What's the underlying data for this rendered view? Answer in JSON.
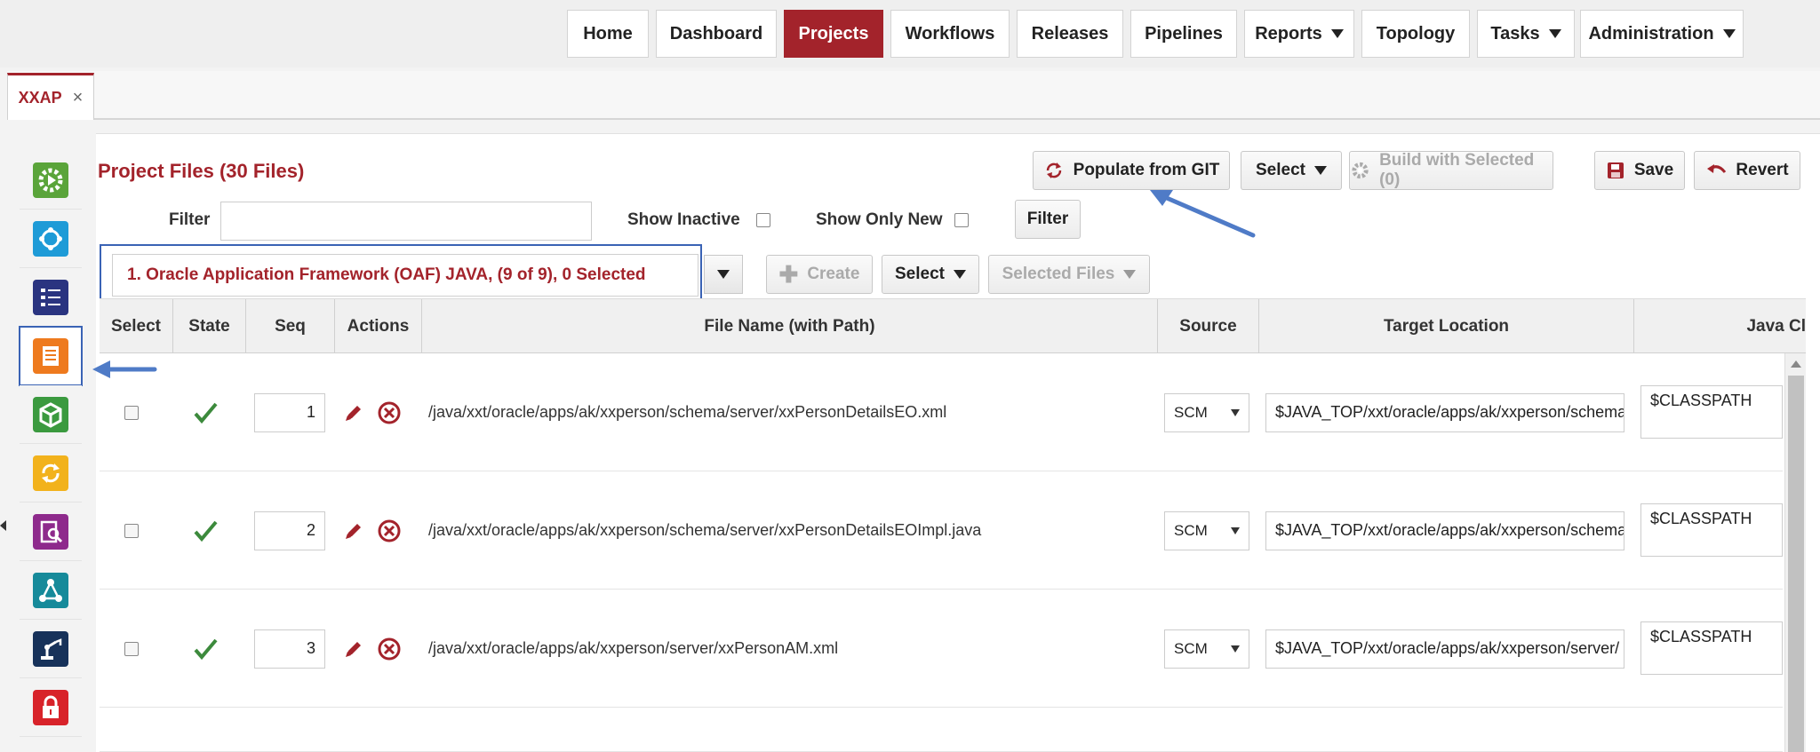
{
  "nav": {
    "items": [
      {
        "label": "Home"
      },
      {
        "label": "Dashboard"
      },
      {
        "label": "Projects"
      },
      {
        "label": "Workflows"
      },
      {
        "label": "Releases"
      },
      {
        "label": "Pipelines"
      },
      {
        "label": "Reports"
      },
      {
        "label": "Topology"
      },
      {
        "label": "Tasks"
      },
      {
        "label": "Administration"
      }
    ],
    "active": "Projects"
  },
  "tab": {
    "label": "XXAP",
    "close": "×"
  },
  "sidebar": {
    "icons": [
      "deploy-gear-icon",
      "network-icon",
      "checklist-icon",
      "project-files-icon",
      "package-cube-icon",
      "refresh-icon",
      "report-search-icon",
      "topology-icon",
      "robot-arm-icon",
      "lock-icon"
    ]
  },
  "page": {
    "title": "Project Files (30 Files)"
  },
  "toolbar": {
    "populate_label": "Populate from GIT",
    "select_label": "Select",
    "build_label": "Build with Selected (0)",
    "save_label": "Save",
    "revert_label": "Revert"
  },
  "filters": {
    "filter_label": "Filter",
    "filter_value": "",
    "show_inactive_label": "Show Inactive",
    "show_only_new_label": "Show Only New",
    "filter_button": "Filter"
  },
  "group": {
    "selected": "1. Oracle Application Framework (OAF) JAVA, (9 of 9), 0 Selected",
    "create_label": "Create",
    "select_label": "Select",
    "selected_files_label": "Selected Files"
  },
  "table": {
    "headers": [
      "Select",
      "State",
      "Seq",
      "Actions",
      "File Name (with Path)",
      "Source",
      "Target Location",
      "Java Cl"
    ],
    "rows": [
      {
        "seq": "1",
        "file": "/java/xxt/oracle/apps/ak/xxperson/schema/server/xxPersonDetailsEO.xml",
        "source": "SCM",
        "target": "$JAVA_TOP/xxt/oracle/apps/ak/xxperson/schema",
        "classpath": "$CLASSPATH"
      },
      {
        "seq": "2",
        "file": "/java/xxt/oracle/apps/ak/xxperson/schema/server/xxPersonDetailsEOImpl.java",
        "source": "SCM",
        "target": "$JAVA_TOP/xxt/oracle/apps/ak/xxperson/schema",
        "classpath": "$CLASSPATH"
      },
      {
        "seq": "3",
        "file": "/java/xxt/oracle/apps/ak/xxperson/server/xxPersonAM.xml",
        "source": "SCM",
        "target": "$JAVA_TOP/xxt/oracle/apps/ak/xxperson/server/",
        "classpath": "$CLASSPATH"
      }
    ]
  },
  "colors": {
    "brand": "#a3232b",
    "highlight": "#3a63b5",
    "check": "#3c8a3c"
  }
}
